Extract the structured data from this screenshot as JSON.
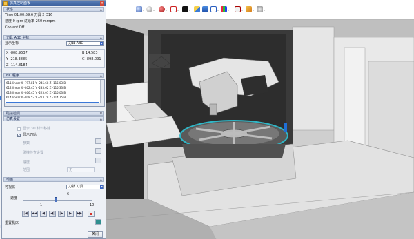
{
  "dialog": {
    "title": "仿真控制面板",
    "status": {
      "header": "状态",
      "time_line": "Time 01:00:59.6 刀具 2   D16",
      "speed_line": "速度 0 rpm        进给率 250 mmpm",
      "coolant": "Coolant Off"
    },
    "tool_coords": {
      "header": "刀具 ABC 坐标",
      "display_label": "显示坐标",
      "display_value": "刀具 ABC",
      "x": "X -808.9537",
      "y": "Y -218.3885",
      "z": "Z -114.8184",
      "b": "B 14.583",
      "c": "C -898.091"
    },
    "nc_program": {
      "header": "NC 程序",
      "lines": [
        "611 linear X -797.81 Y -245.68 Z -115.03 B",
        "612 linear X -802.45 Y -233.62 Z -115.33 B",
        "613 linear X -806.45 Y -223.05 Z -115.03 B",
        "614 linear X -809.52 Y -213.78 Z -114.75 B"
      ]
    },
    "more_sections": {
      "ops_label": "碰撞检测",
      "sim_settings": "仿真设置"
    },
    "options": {
      "show_3d_label": "显示 3D 材料移除",
      "show_tool_label": "显示刀轨",
      "param_label": "参数",
      "collision_label": "碰撞检查设置",
      "speed_label": "速度",
      "range_label": "范围",
      "range_value": "无"
    },
    "animation": {
      "header": "动画",
      "visualize_label": "可视化",
      "visualize_value": "刀轨 刀具",
      "speed_label": "速度",
      "slider_value": "6",
      "slider_min": "1",
      "slider_max": "10",
      "machine_label": "重置机床"
    },
    "ok_label": "关闭"
  },
  "left_strip": {
    "selected_color": "#3a78d8"
  },
  "toolbar": {
    "icons": [
      "render-style-icon",
      "sphere-icon",
      "color-ball-icon",
      "wireframe-icon",
      "black-square-icon",
      "palette-icon",
      "view-icon",
      "filter-icon",
      "csys-icon",
      "paint-icon"
    ]
  },
  "colors": {
    "title_bar": "#3b5f9c",
    "highlight": "#3a78d8",
    "viewport_bg": "#d7d7d7",
    "table_ring": "#2fb7c7"
  }
}
